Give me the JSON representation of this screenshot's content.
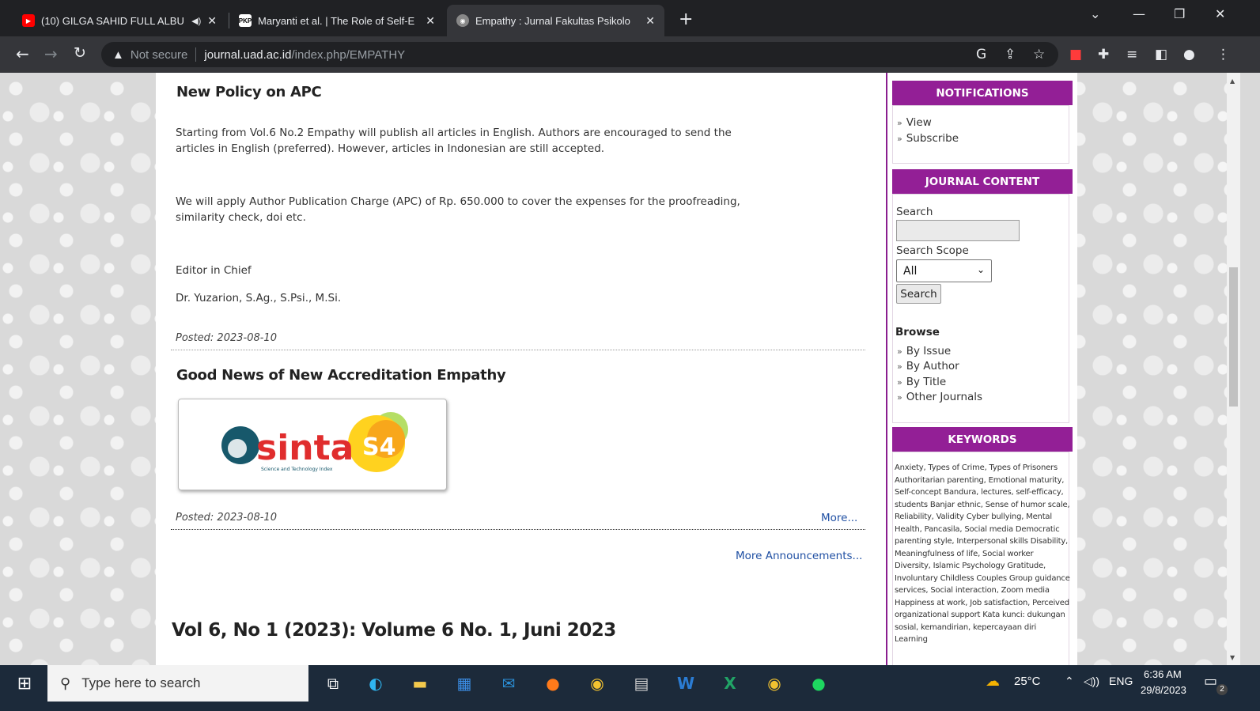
{
  "browser": {
    "tabs": [
      {
        "title": "(10) GILGA SAHID FULL ALBU",
        "favicon": "youtube-icon",
        "audio": true,
        "active": false
      },
      {
        "title": "Maryanti et al. | The Role of Self-E",
        "favicon": "pkp-icon",
        "active": false
      },
      {
        "title": "Empathy : Jurnal Fakultas Psikolo",
        "favicon": "journal-icon",
        "active": true
      }
    ],
    "pkp_favicon_text": "PKP",
    "new_tab_symbol": "+",
    "security_label": "Not secure",
    "url_host": "journal.uad.ac.id",
    "url_path": "/index.php/EMPATHY"
  },
  "announcements": [
    {
      "title": "New Policy on APC",
      "paragraphs": [
        "Starting from Vol.6 No.2 Empathy will publish all articles in English. Authors are encouraged to send the articles in English (preferred). However, articles in Indonesian are still accepted.",
        "We will apply Author Publication Charge (APC) of Rp. 650.000 to cover the expenses for the proofreading, similarity check, doi etc.",
        "Editor in Chief",
        "Dr. Yuzarion, S.Ag., S.Psi., M.Si."
      ],
      "posted": "Posted: 2023-08-10"
    },
    {
      "title": "Good News of New Accreditation Empathy",
      "image_text": "sinta",
      "image_badge": "S4",
      "image_caption": "Science and Technology Index",
      "posted": "Posted: 2023-08-10",
      "more": "More..."
    }
  ],
  "more_announcements": "More Announcements...",
  "issue_title": "Vol 6, No 1 (2023): Volume 6 No. 1, Juni 2023",
  "sidebar": {
    "notifications": {
      "title": "NOTIFICATIONS",
      "links": [
        "View",
        "Subscribe"
      ]
    },
    "journal_content": {
      "title": "JOURNAL CONTENT",
      "search_label": "Search",
      "scope_label": "Search Scope",
      "scope_value": "All",
      "search_button": "Search",
      "browse_label": "Browse",
      "browse_links": [
        "By Issue",
        "By Author",
        "By Title",
        "Other Journals"
      ]
    },
    "keywords": {
      "title": "KEYWORDS",
      "text": "Anxiety, Types of Crime, Types of Prisoners Authoritarian parenting, Emotional maturity, Self-concept Bandura, lectures, self-efficacy, students Banjar ethnic, Sense of humor scale, Reliability, Validity Cyber bullying, Mental Health, Pancasila, Social media Democratic parenting style, Interpersonal skills Disability, Meaningfulness of life, Social worker Diversity, Islamic Psychology Gratitude, Involuntary Childless Couples Group guidance services, Social interaction, Zoom media Happiness at work, Job satisfaction, Perceived organizational support Kata kunci: dukungan sosial, kemandirian, kepercayaan diri Learning"
    }
  },
  "taskbar": {
    "search_placeholder": "Type here to search",
    "weather": "25°C",
    "language": "ENG",
    "time": "6:36 AM",
    "date": "29/8/2023",
    "notification_count": "2"
  },
  "colors": {
    "accent": "#931f96",
    "link": "#1f4fa3"
  }
}
